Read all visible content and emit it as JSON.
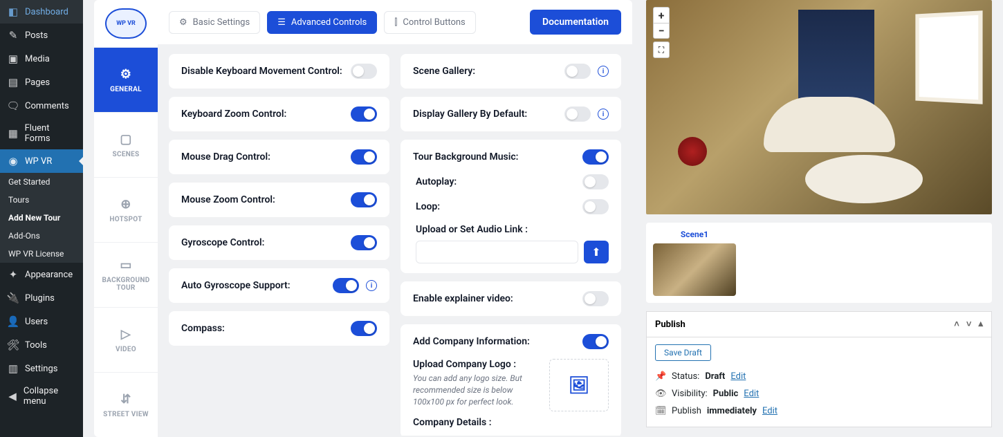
{
  "wp_sidebar": {
    "items": [
      {
        "icon": "◧",
        "label": "Dashboard"
      },
      {
        "icon": "✎",
        "label": "Posts"
      },
      {
        "icon": "▣",
        "label": "Media"
      },
      {
        "icon": "▤",
        "label": "Pages"
      },
      {
        "icon": "🗨",
        "label": "Comments"
      },
      {
        "icon": "▦",
        "label": "Fluent Forms"
      },
      {
        "icon": "◉",
        "label": "WP VR",
        "active": true,
        "submenu": [
          {
            "label": "Get Started"
          },
          {
            "label": "Tours"
          },
          {
            "label": "Add New Tour",
            "current": true
          },
          {
            "label": "Add-Ons"
          },
          {
            "label": "WP VR License"
          }
        ]
      },
      {
        "icon": "✦",
        "label": "Appearance"
      },
      {
        "icon": "🔌",
        "label": "Plugins"
      },
      {
        "icon": "👤",
        "label": "Users"
      },
      {
        "icon": "🛠",
        "label": "Tools"
      },
      {
        "icon": "▥",
        "label": "Settings"
      },
      {
        "icon": "◀",
        "label": "Collapse menu"
      }
    ]
  },
  "brand": "WP VR",
  "vtabs": [
    {
      "icon": "⚙",
      "label": "GENERAL",
      "active": true
    },
    {
      "icon": "▢",
      "label": "SCENES"
    },
    {
      "icon": "⊕",
      "label": "HOTSPOT"
    },
    {
      "icon": "▭",
      "label": "BACKGROUND TOUR"
    },
    {
      "icon": "▷",
      "label": "VIDEO"
    },
    {
      "icon": "⇵",
      "label": "STREET VIEW"
    }
  ],
  "ttabs": [
    {
      "icon": "⚙",
      "label": "Basic Settings"
    },
    {
      "icon": "☰",
      "label": "Advanced Controls",
      "active": true
    },
    {
      "icon": "⫿",
      "label": "Control Buttons"
    }
  ],
  "doc_btn": "Documentation",
  "left_settings": [
    {
      "label": "Disable Keyboard Movement Control:",
      "on": false
    },
    {
      "label": "Keyboard Zoom Control:",
      "on": true
    },
    {
      "label": "Mouse Drag Control:",
      "on": true
    },
    {
      "label": "Mouse Zoom Control:",
      "on": true
    },
    {
      "label": "Gyroscope Control:",
      "on": true
    },
    {
      "label": "Auto Gyroscope Support:",
      "on": true,
      "info": true
    },
    {
      "label": "Compass:",
      "on": true
    }
  ],
  "right_settings": {
    "scene_gallery": {
      "label": "Scene Gallery:",
      "on": false,
      "info": true
    },
    "display_gallery": {
      "label": "Display Gallery By Default:",
      "on": false,
      "info": true
    },
    "bg_music": {
      "label": "Tour Background Music:",
      "on": true,
      "autoplay": {
        "label": "Autoplay:",
        "on": false
      },
      "loop": {
        "label": "Loop:",
        "on": false
      },
      "upload_label": "Upload or Set Audio Link :"
    },
    "explainer": {
      "label": "Enable explainer video:",
      "on": false
    },
    "company": {
      "label": "Add Company Information:",
      "on": true,
      "logo_title": "Upload Company Logo :",
      "logo_desc": "You can add any logo size. But recommended size is below 100x100 px for perfect look.",
      "details_label": "Company Details :"
    }
  },
  "zoom": {
    "in": "+",
    "out": "−",
    "fs": "⛶"
  },
  "scene": {
    "name": "Scene1"
  },
  "publish": {
    "header": "Publish",
    "save_draft": "Save Draft",
    "status_lbl": "Status:",
    "status_val": "Draft",
    "edit": "Edit",
    "vis_lbl": "Visibility:",
    "vis_val": "Public",
    "pub_lbl": "Publish",
    "pub_val": "immediately"
  }
}
